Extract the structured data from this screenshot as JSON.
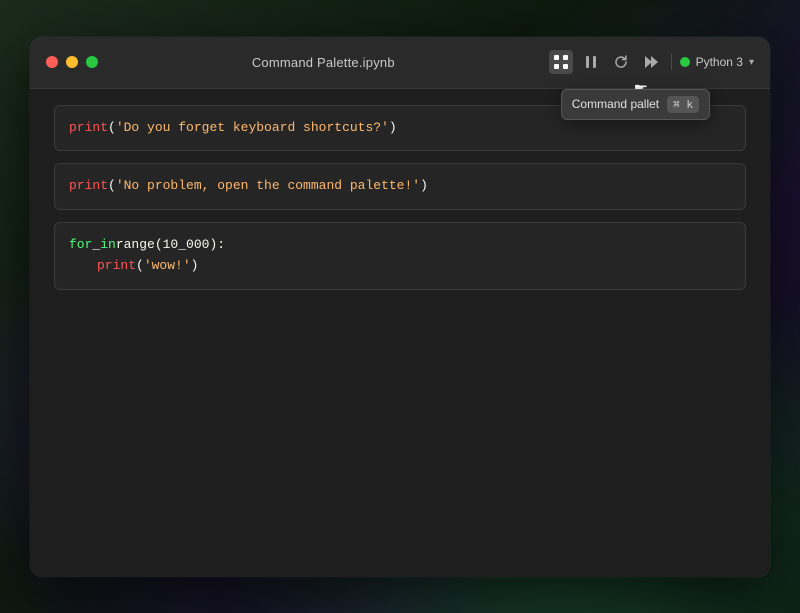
{
  "window": {
    "title": "Command Palette.ipynb"
  },
  "titlebar": {
    "traffic_lights": [
      "close",
      "minimize",
      "maximize"
    ],
    "title": "Command Palette.ipynb",
    "kernel_status": "idle",
    "python_label": "Python 3"
  },
  "tooltip": {
    "label": "Command pallet",
    "shortcut": "⌘ k"
  },
  "cells": [
    {
      "id": "cell1",
      "lines": [
        {
          "parts": [
            {
              "type": "func",
              "text": "print"
            },
            {
              "type": "default",
              "text": "("
            },
            {
              "type": "string",
              "text": "'Do you forget keyboard shortcuts?'"
            },
            {
              "type": "default",
              "text": ")"
            }
          ]
        }
      ]
    },
    {
      "id": "cell2",
      "lines": [
        {
          "parts": [
            {
              "type": "func",
              "text": "print"
            },
            {
              "type": "default",
              "text": "("
            },
            {
              "type": "string",
              "text": "'No problem, open the command palette!'"
            },
            {
              "type": "default",
              "text": ")"
            }
          ]
        }
      ]
    },
    {
      "id": "cell3",
      "lines": [
        {
          "parts": [
            {
              "type": "keyword",
              "text": "for"
            },
            {
              "type": "default",
              "text": " _ "
            },
            {
              "type": "keyword",
              "text": "in"
            },
            {
              "type": "default",
              "text": " range(10_000):"
            }
          ]
        },
        {
          "indent": true,
          "parts": [
            {
              "type": "func",
              "text": "print"
            },
            {
              "type": "default",
              "text": "("
            },
            {
              "type": "string",
              "text": "'wow!'"
            },
            {
              "type": "default",
              "text": ")"
            }
          ]
        }
      ]
    }
  ]
}
